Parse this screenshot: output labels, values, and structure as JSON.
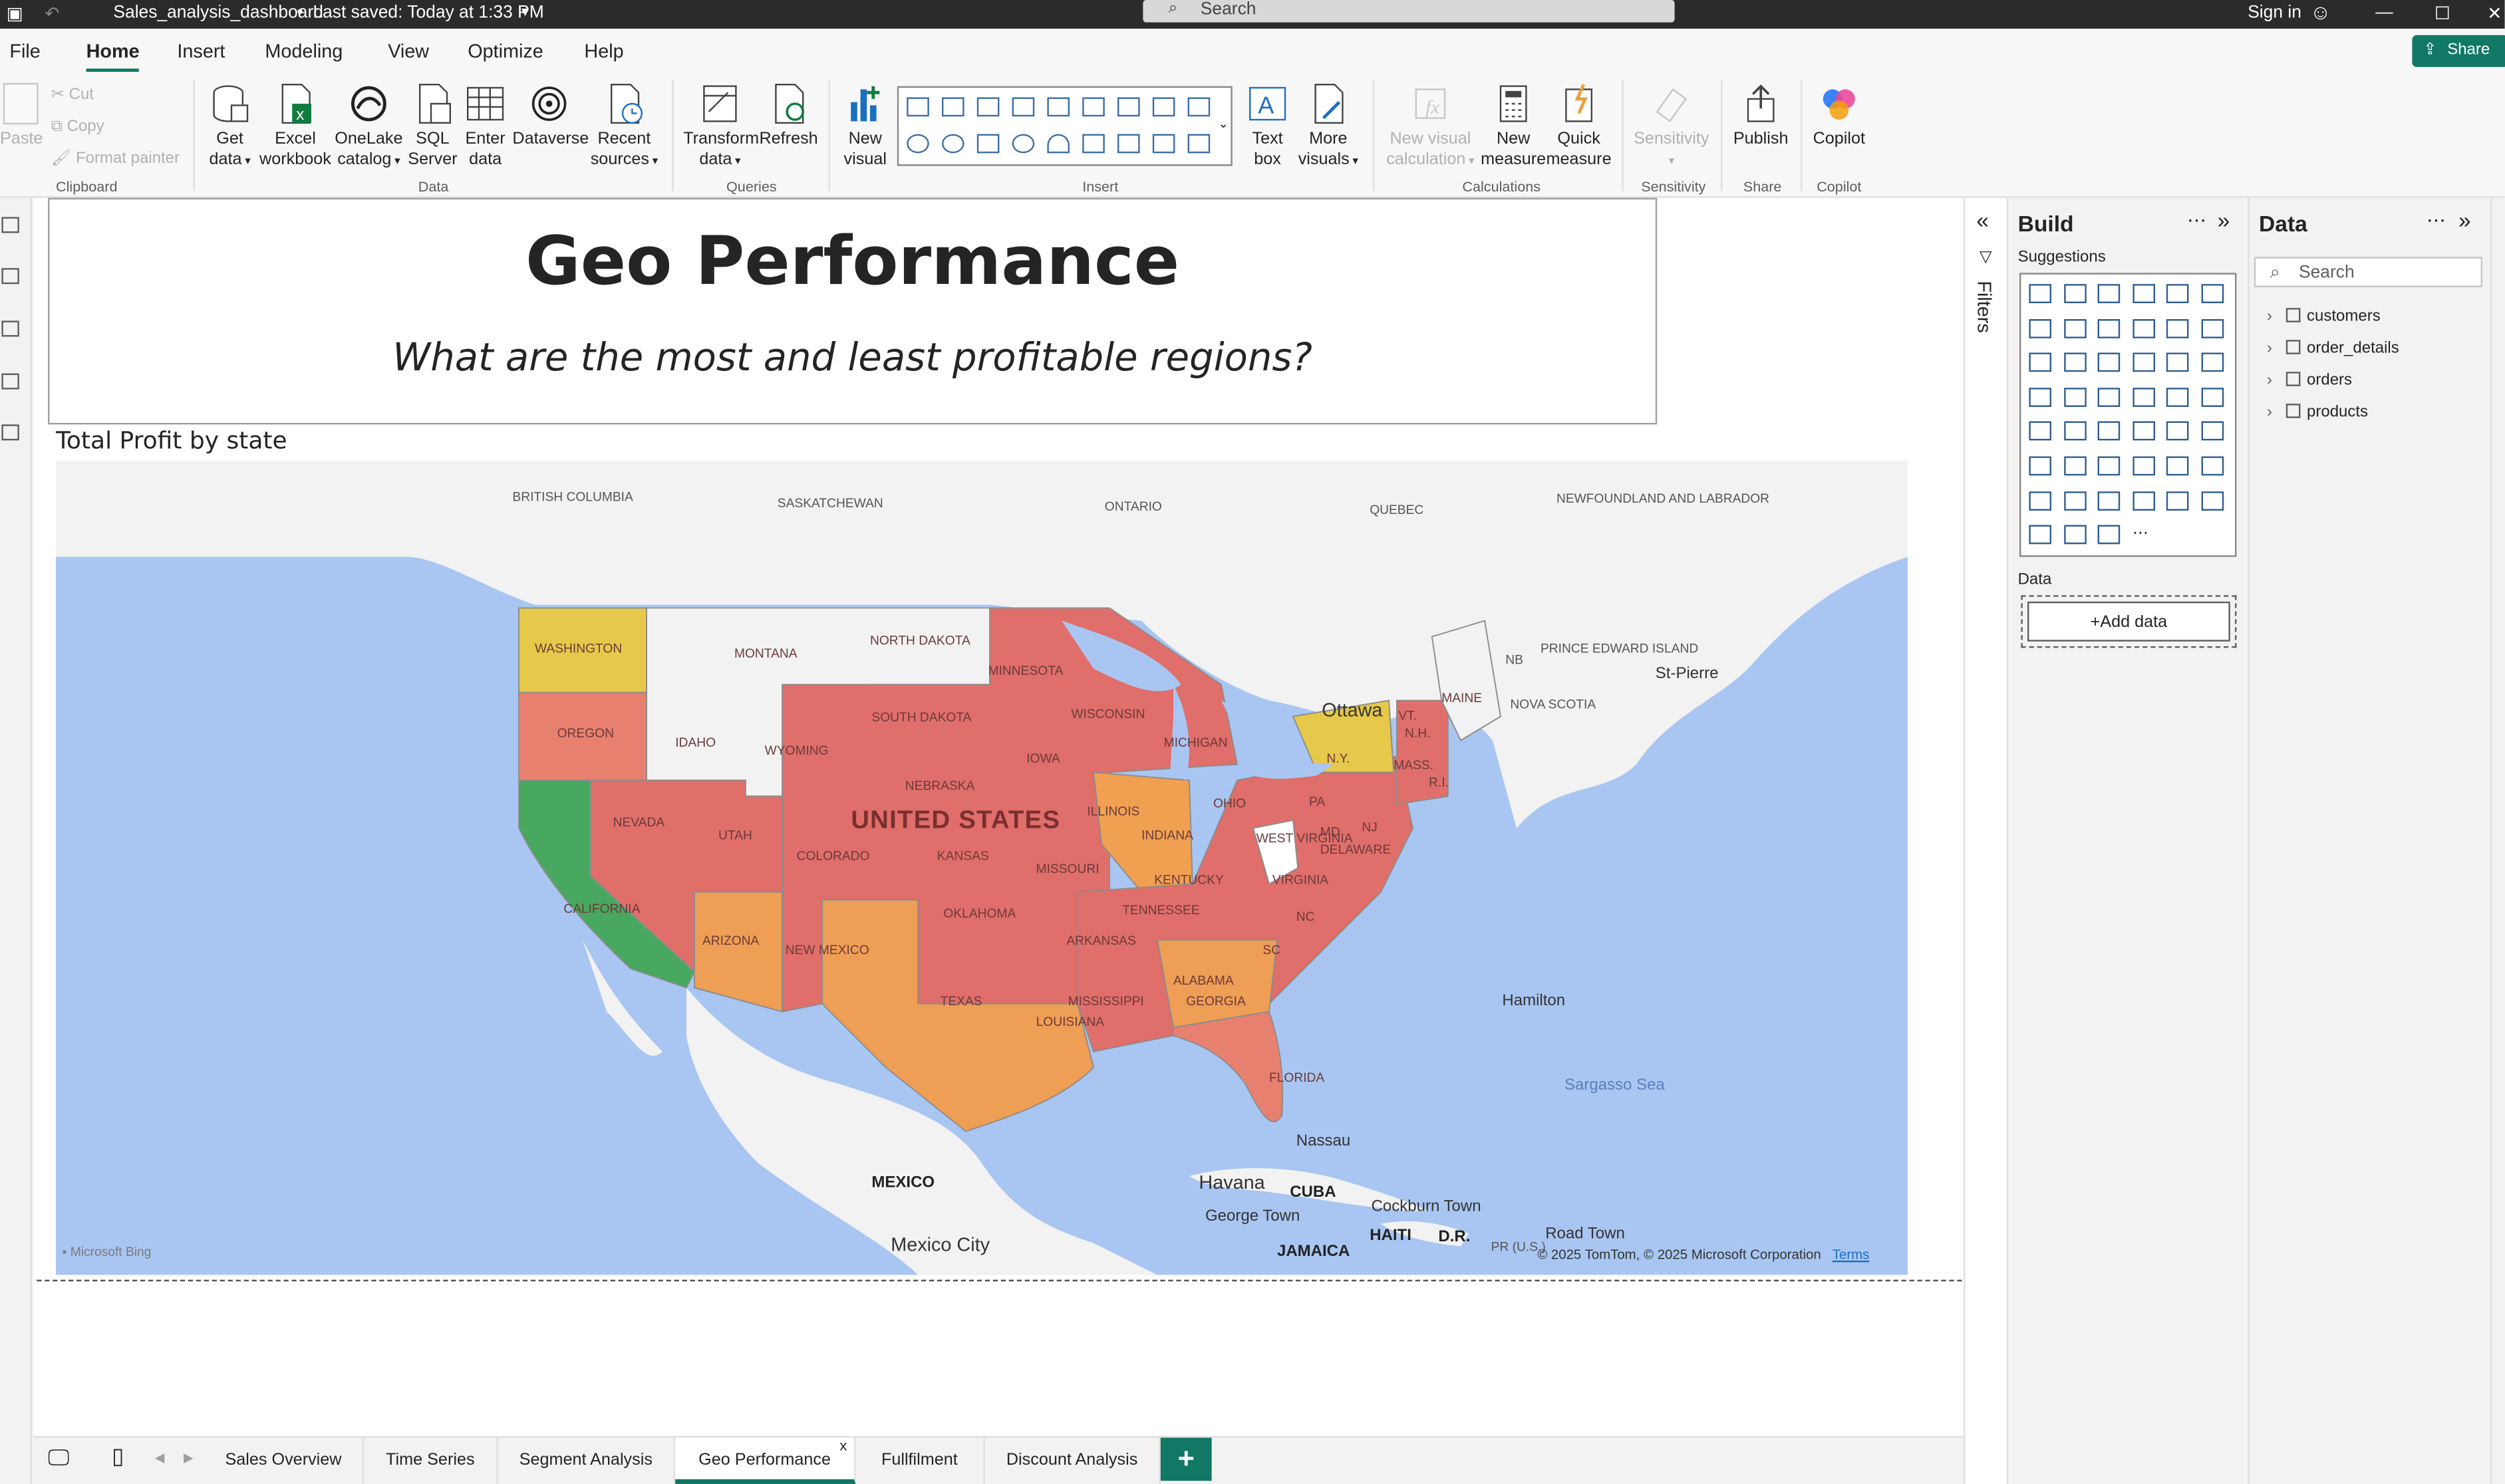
{
  "titlebar": {
    "file": "Sales_analysis_dashboard",
    "saved": "Last saved: Today at 1:33 PM",
    "search": "Search",
    "signin": "Sign in"
  },
  "menu": {
    "items": [
      "File",
      "Home",
      "Insert",
      "Modeling",
      "View",
      "Optimize",
      "Help"
    ],
    "active": "Home",
    "share": "Share"
  },
  "ribbon": {
    "clipboard": {
      "paste": "Paste",
      "cut": "Cut",
      "copy": "Copy",
      "format_painter": "Format painter",
      "group": "Clipboard"
    },
    "data": {
      "get_data": [
        "Get",
        "data"
      ],
      "excel": [
        "Excel",
        "workbook"
      ],
      "onelake": [
        "OneLake",
        "catalog"
      ],
      "sql": [
        "SQL",
        "Server"
      ],
      "enter": [
        "Enter",
        "data"
      ],
      "dataverse": "Dataverse",
      "recent": [
        "Recent",
        "sources"
      ],
      "group": "Data"
    },
    "queries": {
      "transform": [
        "Transform",
        "data"
      ],
      "refresh": "Refresh",
      "group": "Queries"
    },
    "insert": {
      "new_visual": [
        "New",
        "visual"
      ],
      "text_box": [
        "Text",
        "box"
      ],
      "more_visuals": [
        "More",
        "visuals"
      ],
      "group": "Insert"
    },
    "calculations": {
      "new_visual_calc": [
        "New visual",
        "calculation"
      ],
      "new_measure": [
        "New",
        "measure"
      ],
      "quick_measure": [
        "Quick",
        "measure"
      ],
      "group": "Calculations"
    },
    "sensitivity": {
      "label": "Sensitivity",
      "group": "Sensitivity"
    },
    "share": {
      "publish": "Publish",
      "group": "Share"
    },
    "copilot": {
      "label": "Copilot",
      "group": "Copilot"
    }
  },
  "report": {
    "title": "Geo Performance",
    "subtitle": "What are the most and least profitable regions?",
    "visual_title": "Total Profit by state"
  },
  "map": {
    "country_label": "UNITED STATES",
    "state_labels": [
      "WASHINGTON",
      "OREGON",
      "CALIFORNIA",
      "NEVADA",
      "IDAHO",
      "MONTANA",
      "WYOMING",
      "UTAH",
      "ARIZONA",
      "COLORADO",
      "NEW MEXICO",
      "NORTH DAKOTA",
      "SOUTH DAKOTA",
      "NEBRASKA",
      "KANSAS",
      "OKLAHOMA",
      "TEXAS",
      "MINNESOTA",
      "IOWA",
      "MISSOURI",
      "ARKANSAS",
      "LOUISIANA",
      "WISCONSIN",
      "ILLINOIS",
      "MISSISSIPPI",
      "MICHIGAN",
      "INDIANA",
      "KENTUCKY",
      "TENNESSEE",
      "ALABAMA",
      "GEORGIA",
      "FLORIDA",
      "OHIO",
      "WEST VIRGINIA",
      "VIRGINIA",
      "NC",
      "SC",
      "PA",
      "N.Y.",
      "MD",
      "NJ",
      "DELAWARE",
      "MASS.",
      "VT.",
      "N.H.",
      "MAINE",
      "R.I."
    ],
    "region_labels": [
      "BRITISH COLUMBIA",
      "SASKATCHEWAN",
      "ONTARIO",
      "QUEBEC",
      "NEWFOUNDLAND AND LABRADOR",
      "NB",
      "PRINCE EDWARD ISLAND",
      "NOVA SCOTIA",
      "MEXICO",
      "CUBA",
      "HAITI",
      "D.R.",
      "JAMAICA",
      "PR (U.S.)"
    ],
    "city_labels": [
      "Ottawa",
      "St-Pierre",
      "Hamilton",
      "Nassau",
      "Havana",
      "George Town",
      "Cockburn Town",
      "Road Town",
      "Mexico City"
    ],
    "sea_label": "Sargasso Sea",
    "attribution": "© 2025 TomTom, © 2025 Microsoft Corporation",
    "terms": "Terms",
    "bing": "Microsoft Bing",
    "colors": {
      "low": "#e06666",
      "mid": "#f0a050",
      "high": "#48a860",
      "warn": "#e6c84a",
      "nodata": "#f2f2f2",
      "water": "#a9c6f2"
    }
  },
  "tabs": [
    "Sales Overview",
    "Time Series",
    "Segment Analysis",
    "Geo Performance",
    "Fullfilment",
    "Discount Analysis"
  ],
  "active_tab": "Geo Performance",
  "build": {
    "title": "Build",
    "suggestions": "Suggestions",
    "data_label": "Data",
    "add_data": "+Add data"
  },
  "filters": {
    "label": "Filters"
  },
  "data_pane": {
    "title": "Data",
    "search": "Search",
    "tables": [
      "customers",
      "order_details",
      "orders",
      "products"
    ]
  }
}
